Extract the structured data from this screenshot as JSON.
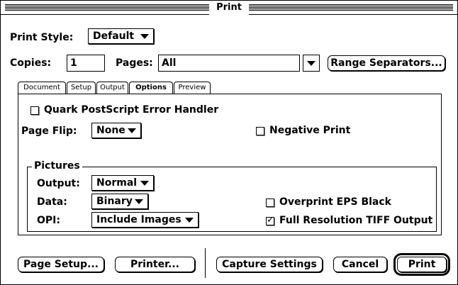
{
  "window": {
    "title": "Print"
  },
  "print_style": {
    "label": "Print Style:",
    "value": "Default"
  },
  "copies": {
    "label": "Copies:",
    "value": "1"
  },
  "pages": {
    "label": "Pages:",
    "value": "All"
  },
  "range_separators_label": "Range Separators...",
  "tabs": [
    {
      "label": "Document"
    },
    {
      "label": "Setup"
    },
    {
      "label": "Output"
    },
    {
      "label": "Options"
    },
    {
      "label": "Preview"
    }
  ],
  "active_tab": "Options",
  "options": {
    "quark_error_handler": {
      "label": "Quark PostScript Error Handler",
      "checked": false
    },
    "page_flip": {
      "label": "Page Flip:",
      "value": "None"
    },
    "negative_print": {
      "label": "Negative Print",
      "checked": false
    }
  },
  "pictures": {
    "title": "Pictures",
    "output": {
      "label": "Output:",
      "value": "Normal"
    },
    "data": {
      "label": "Data:",
      "value": "Binary"
    },
    "opi": {
      "label": "OPI:",
      "value": "Include Images"
    },
    "overprint_eps_black": {
      "label": "Overprint EPS Black",
      "checked": false
    },
    "full_res_tiff": {
      "label": "Full Resolution TIFF Output",
      "checked": true
    }
  },
  "footer": {
    "page_setup_label": "Page Setup...",
    "printer_label": "Printer...",
    "capture_settings_label": "Capture Settings",
    "cancel_label": "Cancel",
    "print_label": "Print"
  }
}
